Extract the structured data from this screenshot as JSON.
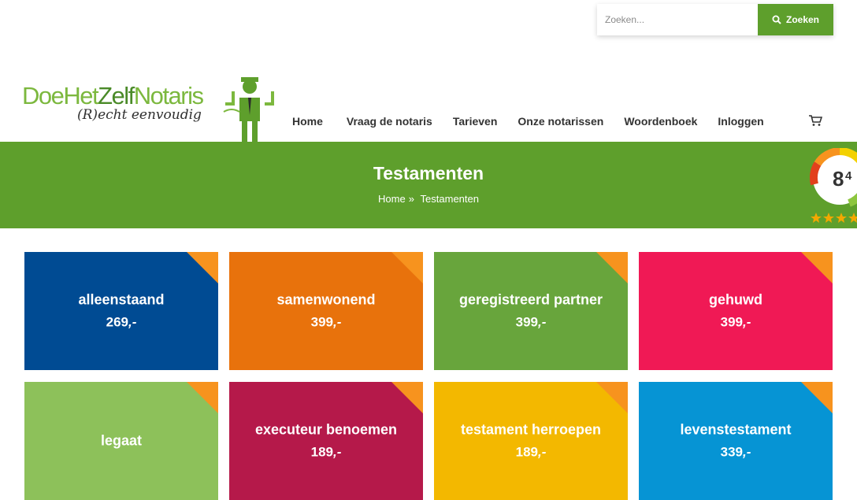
{
  "search": {
    "placeholder": "Zoeken...",
    "button_label": "Zoeken"
  },
  "logo": {
    "word_part1": "DoeHet",
    "word_part2": "Zelf",
    "word_part3": "Notaris",
    "tagline": "(R)echt eenvoudig"
  },
  "nav": {
    "items": [
      "Home",
      "Vraag de notaris",
      "Tarieven",
      "Onze notarissen",
      "Woordenboek",
      "Inloggen"
    ]
  },
  "hero": {
    "title": "Testamenten",
    "breadcrumb": [
      "Home",
      "»",
      "Testamenten"
    ]
  },
  "rating": {
    "score": "8",
    "decimal": "4",
    "stars": 5
  },
  "tiles": [
    {
      "name": "alleenstaand",
      "price": "269",
      "suffix": ",-",
      "color": "#004b93"
    },
    {
      "name": "samenwonend",
      "price": "399",
      "suffix": ",-",
      "color": "#e8720c"
    },
    {
      "name": "geregistreerd partner",
      "price": "399",
      "suffix": ",-",
      "color": "#68a53c"
    },
    {
      "name": "gehuwd",
      "price": "399",
      "suffix": ",-",
      "color": "#f01955"
    },
    {
      "name": "legaat",
      "price": "",
      "suffix": "",
      "color": "#8dc15a"
    },
    {
      "name": "executeur benoemen",
      "price": "189",
      "suffix": ",-",
      "color": "#b5194a"
    },
    {
      "name": "testament herroepen",
      "price": "189",
      "suffix": ",-",
      "color": "#f3b800"
    },
    {
      "name": "levenstestament",
      "price": "339",
      "suffix": ",-",
      "color": "#0694d4"
    }
  ],
  "colors": {
    "brand_green": "#5e9f2c",
    "corner_orange": "#f7931e"
  }
}
